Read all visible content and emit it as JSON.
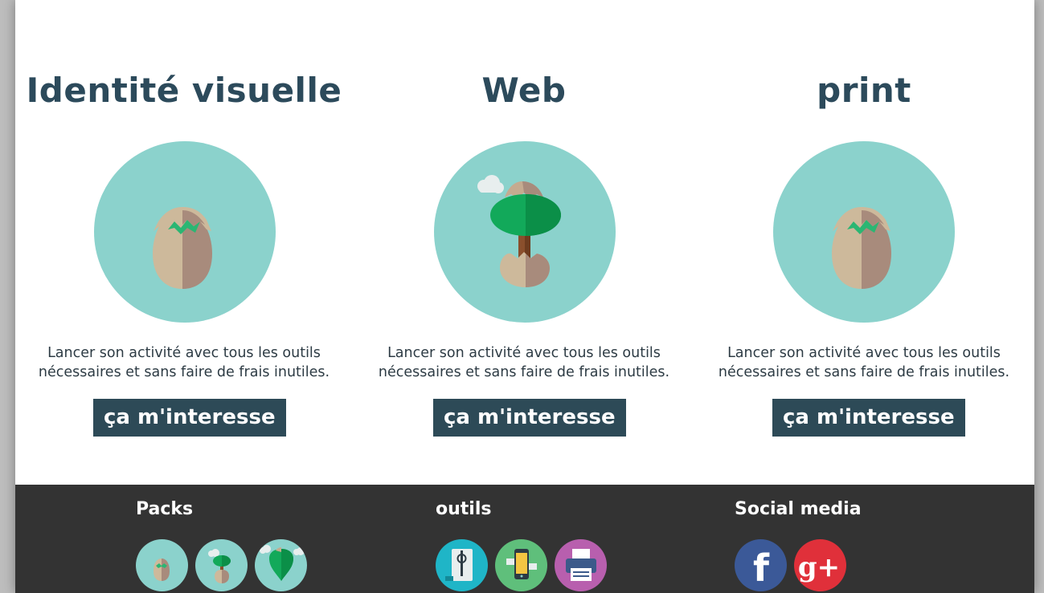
{
  "services": [
    {
      "title": "Identité visuelle",
      "icon": "egg-hatching-icon",
      "description_line1": "Lancer son activité avec tous les outils",
      "description_line2": "nécessaires et sans faire de frais inutiles.",
      "button_label": "ça m'interesse"
    },
    {
      "title": "Web",
      "icon": "tree-from-egg-icon",
      "description_line1": "Lancer son activité avec tous les outils",
      "description_line2": "nécessaires et sans faire de frais inutiles.",
      "button_label": "ça m'interesse"
    },
    {
      "title": "print",
      "icon": "egg-hatching-icon",
      "description_line1": "Lancer son activité avec tous les outils",
      "description_line2": "nécessaires et sans faire de frais inutiles.",
      "button_label": "ça m'interesse"
    }
  ],
  "footer": {
    "packs": {
      "title": "Packs",
      "icons": [
        "egg-pack-icon",
        "sprout-pack-icon",
        "balloon-tree-pack-icon"
      ]
    },
    "outils": {
      "title": "outils",
      "icons": [
        "design-tool-icon",
        "mobile-web-icon",
        "printer-icon"
      ]
    },
    "social": {
      "title": "Social media",
      "icons": [
        "facebook-icon",
        "google-plus-icon"
      ],
      "facebook_letter": "f",
      "google_label": "g+"
    }
  },
  "colors": {
    "heading": "#2c4a5b",
    "disc": "#8bd2cc",
    "button_bg": "#2d4a57",
    "footer_bg": "#333333",
    "facebook": "#3b5998",
    "google_plus": "#e0303a"
  }
}
